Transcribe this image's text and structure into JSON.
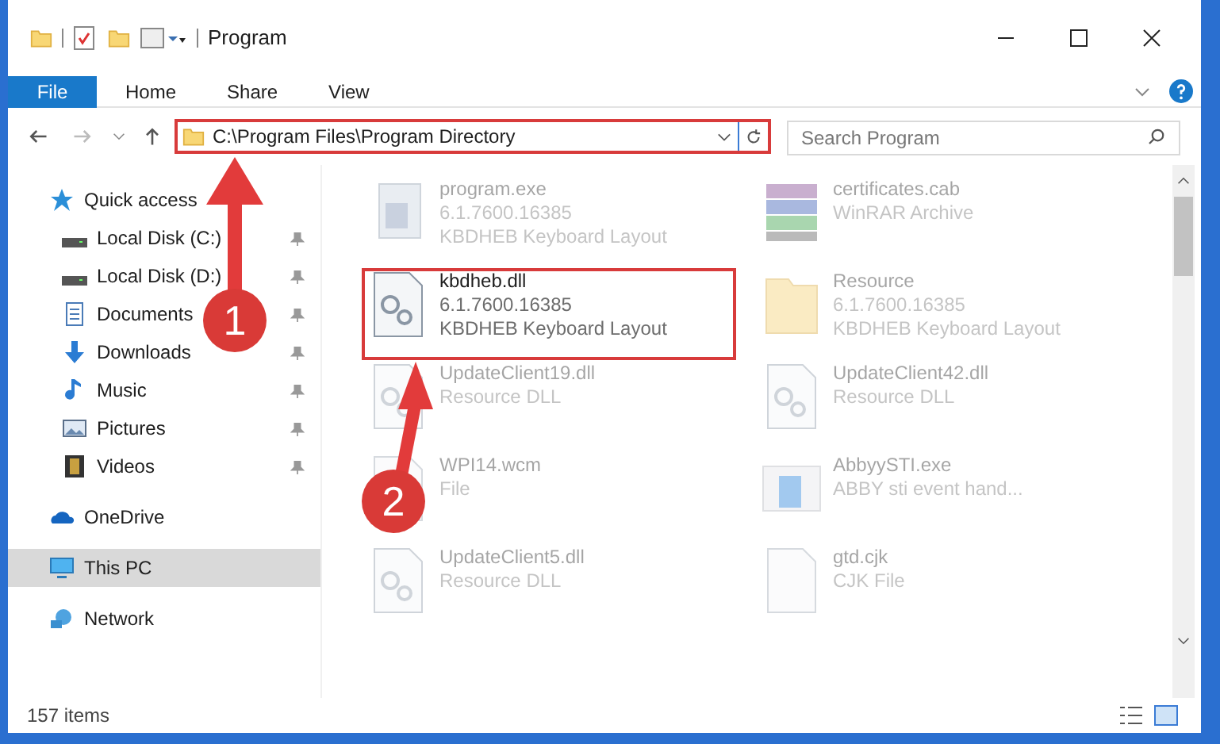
{
  "window": {
    "title": "Program"
  },
  "ribbon_tabs": [
    {
      "label": "File",
      "selected": true
    },
    {
      "label": "Home",
      "selected": false
    },
    {
      "label": "Share",
      "selected": false
    },
    {
      "label": "View",
      "selected": false
    }
  ],
  "address": {
    "path": "C:\\Program Files\\Program Directory"
  },
  "search": {
    "placeholder": "Search Program"
  },
  "sidebar": {
    "items": [
      {
        "label": "Quick access",
        "kind": "star",
        "pinned": false,
        "selected": false,
        "children": [
          {
            "label": "Local Disk (C:)",
            "kind": "drive",
            "pinned": true,
            "selected": false
          },
          {
            "label": "Local Disk (D:)",
            "kind": "drive",
            "pinned": true,
            "selected": false
          },
          {
            "label": "Documents",
            "kind": "docs",
            "pinned": true,
            "selected": false
          },
          {
            "label": "Downloads",
            "kind": "download",
            "pinned": true,
            "selected": false
          },
          {
            "label": "Music",
            "kind": "music",
            "pinned": true,
            "selected": false
          },
          {
            "label": "Pictures",
            "kind": "pictures",
            "pinned": true,
            "selected": false
          },
          {
            "label": "Videos",
            "kind": "videos",
            "pinned": true,
            "selected": false
          }
        ]
      },
      {
        "label": "OneDrive",
        "kind": "cloud",
        "pinned": false,
        "selected": false
      },
      {
        "label": "This PC",
        "kind": "pc",
        "pinned": false,
        "selected": true
      },
      {
        "label": "Network",
        "kind": "network",
        "pinned": false,
        "selected": false
      }
    ]
  },
  "files": [
    {
      "name": "program.exe",
      "details": [
        "6.1.7600.16385",
        "KBDHEB Keyboard Layout"
      ],
      "kind": "exe",
      "faded": true
    },
    {
      "name": "certificates.cab",
      "details": [
        "WinRAR Archive"
      ],
      "kind": "archive",
      "faded": true
    },
    {
      "name": "kbdheb.dll",
      "details": [
        "6.1.7600.16385",
        "KBDHEB Keyboard Layout"
      ],
      "kind": "dll",
      "faded": false
    },
    {
      "name": "Resource",
      "details": [
        "6.1.7600.16385",
        "KBDHEB Keyboard Layout"
      ],
      "kind": "folder",
      "faded": true
    },
    {
      "name": "UpdateClient19.dll",
      "details": [
        "Resource DLL"
      ],
      "kind": "dll",
      "faded": true
    },
    {
      "name": "UpdateClient42.dll",
      "details": [
        "Resource DLL"
      ],
      "kind": "dll",
      "faded": true
    },
    {
      "name": "WPI14.wcm",
      "details": [
        "File"
      ],
      "kind": "file",
      "faded": true
    },
    {
      "name": "AbbyySTI.exe",
      "details": [
        "ABBY sti event hand..."
      ],
      "kind": "app",
      "faded": true
    },
    {
      "name": "UpdateClient5.dll",
      "details": [
        "Resource DLL"
      ],
      "kind": "dll",
      "faded": true
    },
    {
      "name": "gtd.cjk",
      "details": [
        "CJK File"
      ],
      "kind": "file",
      "faded": true
    }
  ],
  "status_bar": {
    "count": "157 items"
  },
  "annotations": [
    {
      "label": "1"
    },
    {
      "label": "2"
    }
  ]
}
